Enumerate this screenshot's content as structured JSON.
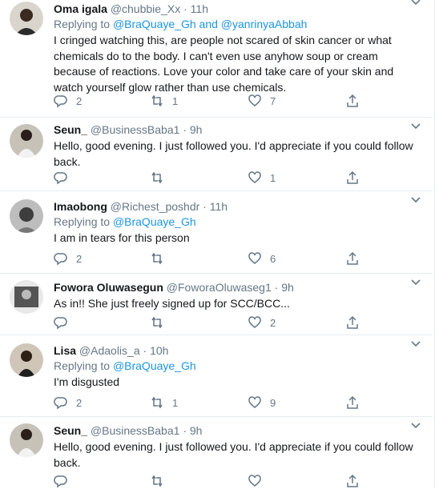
{
  "tweets": [
    {
      "name": "Oma igala",
      "handle": "@chubbie_Xx",
      "time": "11h",
      "replying_label": "Replying to",
      "replying_to": [
        "@BraQuaye_Gh",
        "@yanrinyaAbbah"
      ],
      "replying_joiner": "and",
      "text": "I cringed watching this, are people not scared of skin cancer or what chemicals do to the body. I can't even use anyhow soup or cream because of reactions. Love your color and take care of your skin and watch yourself glow rather than use chemicals.",
      "replies": "2",
      "retweets": "1",
      "likes": "7"
    },
    {
      "name": "Seun_",
      "handle": "@BusinessBaba1",
      "time": "9h",
      "text": "Hello, good evening. I just followed you. I'd appreciate if you could follow back.",
      "replies": "",
      "retweets": "",
      "likes": "1"
    },
    {
      "name": "Imaobong",
      "handle": "@Richest_poshdr",
      "time": "11h",
      "replying_label": "Replying to",
      "replying_to": [
        "@BraQuaye_Gh"
      ],
      "text": "I am in tears for this person",
      "replies": "2",
      "retweets": "",
      "likes": "6"
    },
    {
      "name": "Fowora Oluwasegun",
      "handle": "@FoworaOluwaseg1",
      "time": "9h",
      "text": "As in!! She just freely signed up for SCC/BCC...",
      "replies": "",
      "retweets": "",
      "likes": "2"
    },
    {
      "name": "Lisa",
      "handle": "@Adaolis_a",
      "time": "10h",
      "replying_label": "Replying to",
      "replying_to": [
        "@BraQuaye_Gh"
      ],
      "text": "I'm disgusted",
      "replies": "2",
      "retweets": "1",
      "likes": "9"
    },
    {
      "name": "Seun_",
      "handle": "@BusinessBaba1",
      "time": "9h",
      "text": "Hello, good evening. I just followed you. I'd appreciate if you could follow back.",
      "replies": "",
      "retweets": "",
      "likes": ""
    }
  ],
  "separator": "·",
  "colors": {
    "link": "#1b95e0",
    "muted": "#657786",
    "text": "#14171a",
    "border": "#e6ecf0"
  },
  "icons": [
    "reply-icon",
    "retweet-icon",
    "like-icon",
    "share-icon",
    "caret-down-icon"
  ]
}
